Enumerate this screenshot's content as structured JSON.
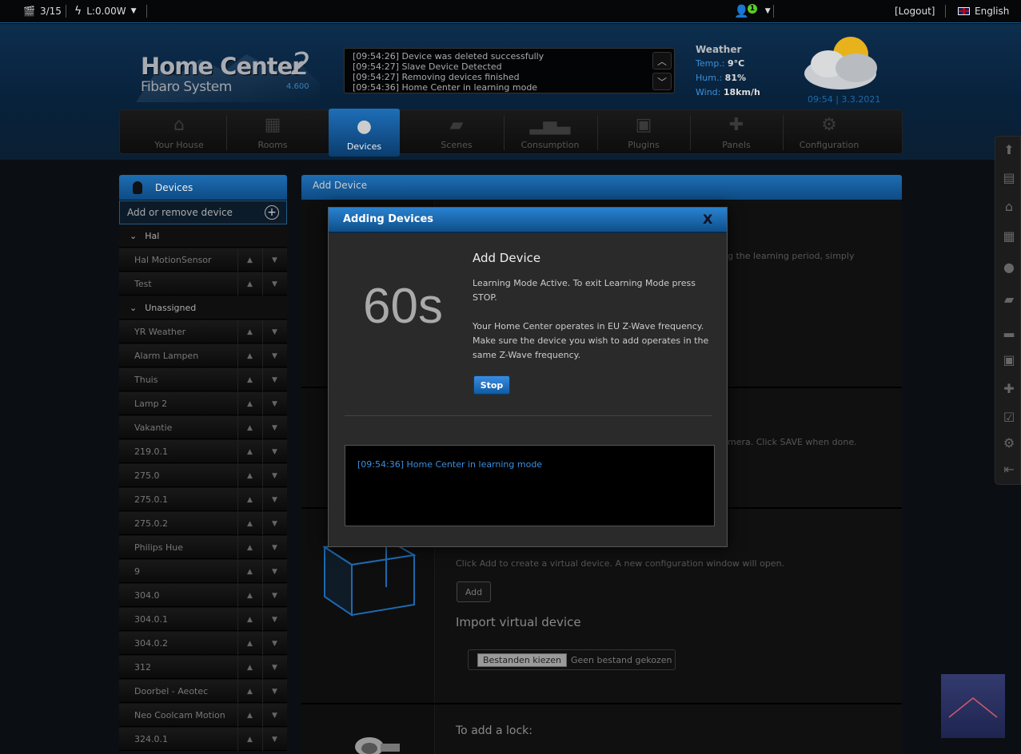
{
  "topbar": {
    "scene_count": "3/15",
    "power": "L:0.00W",
    "user_badge": "1",
    "logout": "[Logout]",
    "language": "English"
  },
  "header": {
    "logo_main": "Home Center",
    "logo_two": "2",
    "logo_sub": "Fibaro System",
    "version": "4.600",
    "log_lines": [
      "[09:54:26] Device was deleted successfully",
      "[09:54:27] Slave Device Detected",
      "[09:54:27] Removing devices finished",
      "[09:54:36] Home Center in learning mode"
    ],
    "weather": {
      "title": "Weather",
      "temp_label": "Temp.:",
      "temp_value": "9°C",
      "hum_label": "Hum.:",
      "hum_value": "81%",
      "wind_label": "Wind:",
      "wind_value": "18km/h",
      "time": "09:54 | 3.3.2021"
    }
  },
  "nav": {
    "items": [
      {
        "label": "Your House",
        "icon": "house-icon"
      },
      {
        "label": "Rooms",
        "icon": "rooms-icon"
      },
      {
        "label": "Devices",
        "icon": "bulb-icon"
      },
      {
        "label": "Scenes",
        "icon": "clapper-icon"
      },
      {
        "label": "Consumption",
        "icon": "chart-icon"
      },
      {
        "label": "Plugins",
        "icon": "plugin-box-icon"
      },
      {
        "label": "Panels",
        "icon": "puzzle-icon"
      },
      {
        "label": "Configuration",
        "icon": "gears-icon"
      }
    ],
    "active": "Devices"
  },
  "sidebar": {
    "title": "Devices",
    "add_label": "Add or remove device",
    "rows": [
      {
        "type": "room",
        "label": "Hal"
      },
      {
        "type": "device",
        "label": "Hal MotionSensor"
      },
      {
        "type": "device",
        "label": "Test"
      },
      {
        "type": "room",
        "label": "Unassigned"
      },
      {
        "type": "device",
        "label": "YR Weather"
      },
      {
        "type": "device",
        "label": "Alarm Lampen"
      },
      {
        "type": "device",
        "label": "Thuis"
      },
      {
        "type": "device",
        "label": "Lamp 2"
      },
      {
        "type": "device",
        "label": "Vakantie"
      },
      {
        "type": "device",
        "label": "219.0.1"
      },
      {
        "type": "device",
        "label": "275.0"
      },
      {
        "type": "device",
        "label": "275.0.1"
      },
      {
        "type": "device",
        "label": "275.0.2"
      },
      {
        "type": "device",
        "label": "Philips Hue"
      },
      {
        "type": "device",
        "label": "9"
      },
      {
        "type": "device",
        "label": "304.0"
      },
      {
        "type": "device",
        "label": "304.0.1"
      },
      {
        "type": "device",
        "label": "304.0.2"
      },
      {
        "type": "device",
        "label": "312"
      },
      {
        "type": "device",
        "label": "Doorbel - Aeotec"
      },
      {
        "type": "device",
        "label": "Neo Coolcam Motion"
      },
      {
        "type": "device",
        "label": "324.0.1"
      }
    ]
  },
  "main": {
    "title": "Add Device",
    "bg_text_1": "g the learning period, simply",
    "bg_text_2": "mera. Click SAVE when done.",
    "virtual_hint": "Click Add to create a virtual device. A new configuration window will open.",
    "virtual_add": "Add",
    "import_title": "Import virtual device",
    "file_button": "Bestanden kiezen",
    "file_status": "Geen bestand gekozen",
    "lock_title": "To add a lock:"
  },
  "modal": {
    "title": "Adding Devices",
    "close": "X",
    "countdown": "60s",
    "heading": "Add Device",
    "text1": "Learning Mode Active. To exit Learning Mode press STOP.",
    "text2": "Your Home Center operates in EU Z-Wave frequency. Make sure the device you wish to add operates in the same Z-Wave frequency.",
    "stop": "Stop",
    "log_line": "[09:54:36] Home Center in learning mode"
  },
  "colors": {
    "accent": "#1e6db3",
    "log_blue": "#3a8fe0",
    "badge_green": "#5ccc2a"
  }
}
